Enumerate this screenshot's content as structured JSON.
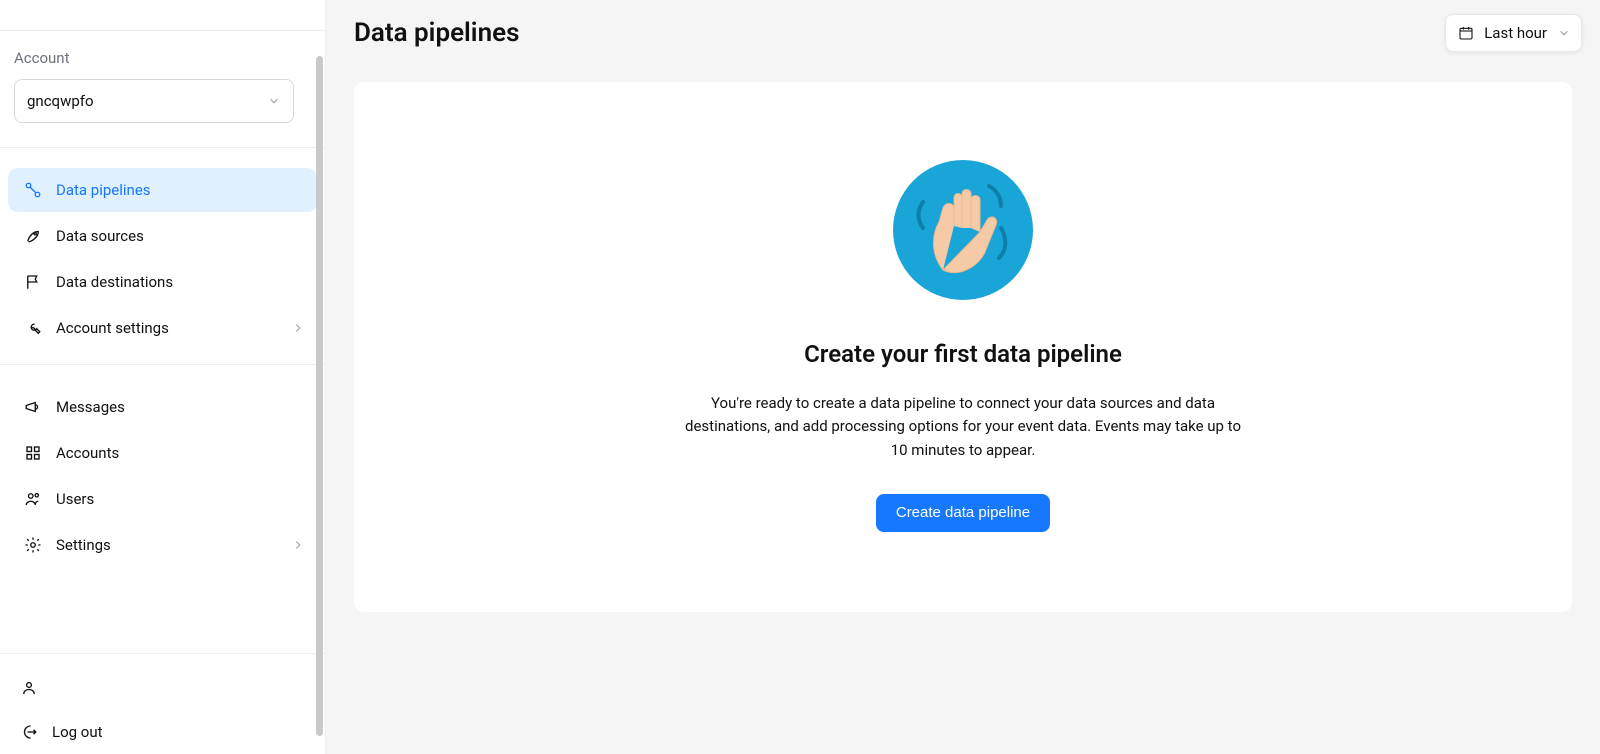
{
  "sidebar": {
    "account_label": "Account",
    "account_value": "gncqwpfo",
    "nav1": {
      "data_pipelines": "Data pipelines",
      "data_sources": "Data sources",
      "data_destinations": "Data destinations",
      "account_settings": "Account settings"
    },
    "nav2": {
      "messages": "Messages",
      "accounts": "Accounts",
      "users": "Users",
      "settings": "Settings"
    },
    "footer": {
      "logout": "Log out"
    }
  },
  "header": {
    "title": "Data pipelines",
    "time_picker": "Last hour"
  },
  "empty_state": {
    "title": "Create your first data pipeline",
    "description": "You're ready to create a data pipeline to connect your data sources and data destinations, and add processing options for your event data. Events may take up to 10 minutes to appear.",
    "button": "Create data pipeline"
  }
}
